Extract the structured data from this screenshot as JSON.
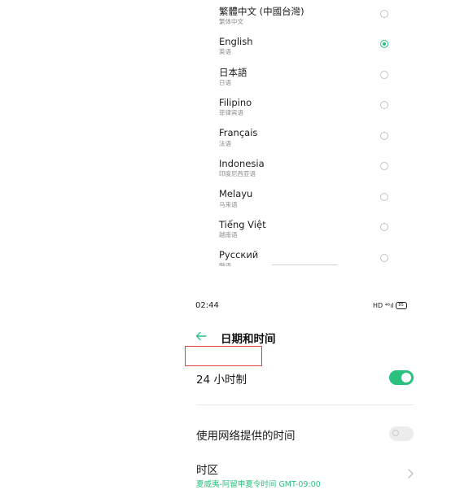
{
  "language_list": {
    "items": [
      {
        "name": "繁體中文 (中國台灣)",
        "sub": "繁体中文",
        "selected": false
      },
      {
        "name": "English",
        "sub": "英语",
        "selected": true
      },
      {
        "name": "日本語",
        "sub": "日语",
        "selected": false
      },
      {
        "name": "Filipino",
        "sub": "菲律宾语",
        "selected": false
      },
      {
        "name": "Français",
        "sub": "法语",
        "selected": false
      },
      {
        "name": "Indonesia",
        "sub": "印度尼西亚语",
        "selected": false
      },
      {
        "name": "Melayu",
        "sub": "马来语",
        "selected": false
      },
      {
        "name": "Tiếng Việt",
        "sub": "越南语",
        "selected": false
      },
      {
        "name": "Русский",
        "sub": "俄语",
        "selected": false
      }
    ]
  },
  "status_bar": {
    "time": "02:44",
    "indicators": "HD ⁴⁶ıl",
    "battery": "85"
  },
  "header": {
    "back_icon": "back-arrow-icon",
    "title": "日期和时间"
  },
  "settings": {
    "hour24": {
      "label": "24 小时制",
      "enabled": true
    },
    "network_time": {
      "label": "使用网络提供的时间",
      "enabled": false
    },
    "timezone": {
      "label": "时区",
      "value": "夏威夷-阿留申夏令时间 GMT-09:00"
    }
  },
  "colors": {
    "accent": "#2ac17e",
    "highlight_box": "#e0423a"
  }
}
